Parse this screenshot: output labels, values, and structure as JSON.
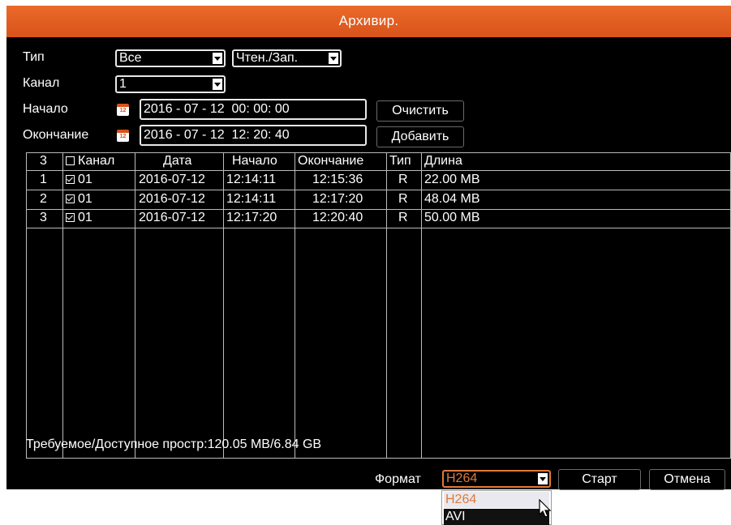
{
  "window": {
    "title": "Архивир."
  },
  "filters": {
    "type_label": "Тип",
    "type_value": "Все",
    "mode_value": "Чтен./Зап.",
    "channel_label": "Канал",
    "channel_value": "1",
    "start_label": "Начало",
    "start_value": "2016 - 07 - 12  00: 00: 00",
    "end_label": "Окончание",
    "end_value": "2016 - 07 - 12  12: 20: 40",
    "calendar_icon_text": "12",
    "clear_button": "Очистить",
    "add_button": "Добавить"
  },
  "table": {
    "headers": [
      "3",
      "Канал",
      "Дата",
      "Начало",
      "Окончание",
      "Тип",
      "Длина"
    ],
    "rows": [
      {
        "n": "1",
        "channel": "01",
        "date": "2016-07-12",
        "start": "12:14:11",
        "end": "12:15:36",
        "type": "R",
        "length": "22.00 MB"
      },
      {
        "n": "2",
        "channel": "01",
        "date": "2016-07-12",
        "start": "12:14:11",
        "end": "12:17:20",
        "type": "R",
        "length": "48.04 MB"
      },
      {
        "n": "3",
        "channel": "01",
        "date": "2016-07-12",
        "start": "12:17:20",
        "end": "12:20:40",
        "type": "R",
        "length": "50.00 MB"
      }
    ]
  },
  "footer": {
    "space_text": "Требуемое/Доступное простр:120.05 MB/6.84 GB",
    "format_label": "Формат",
    "format_value": "H264",
    "format_options": [
      "H264",
      "AVI"
    ],
    "start_button": "Старт",
    "cancel_button": "Отмена"
  },
  "colors": {
    "accent": "#d9531a",
    "background": "#000000",
    "text": "#ffffff"
  }
}
